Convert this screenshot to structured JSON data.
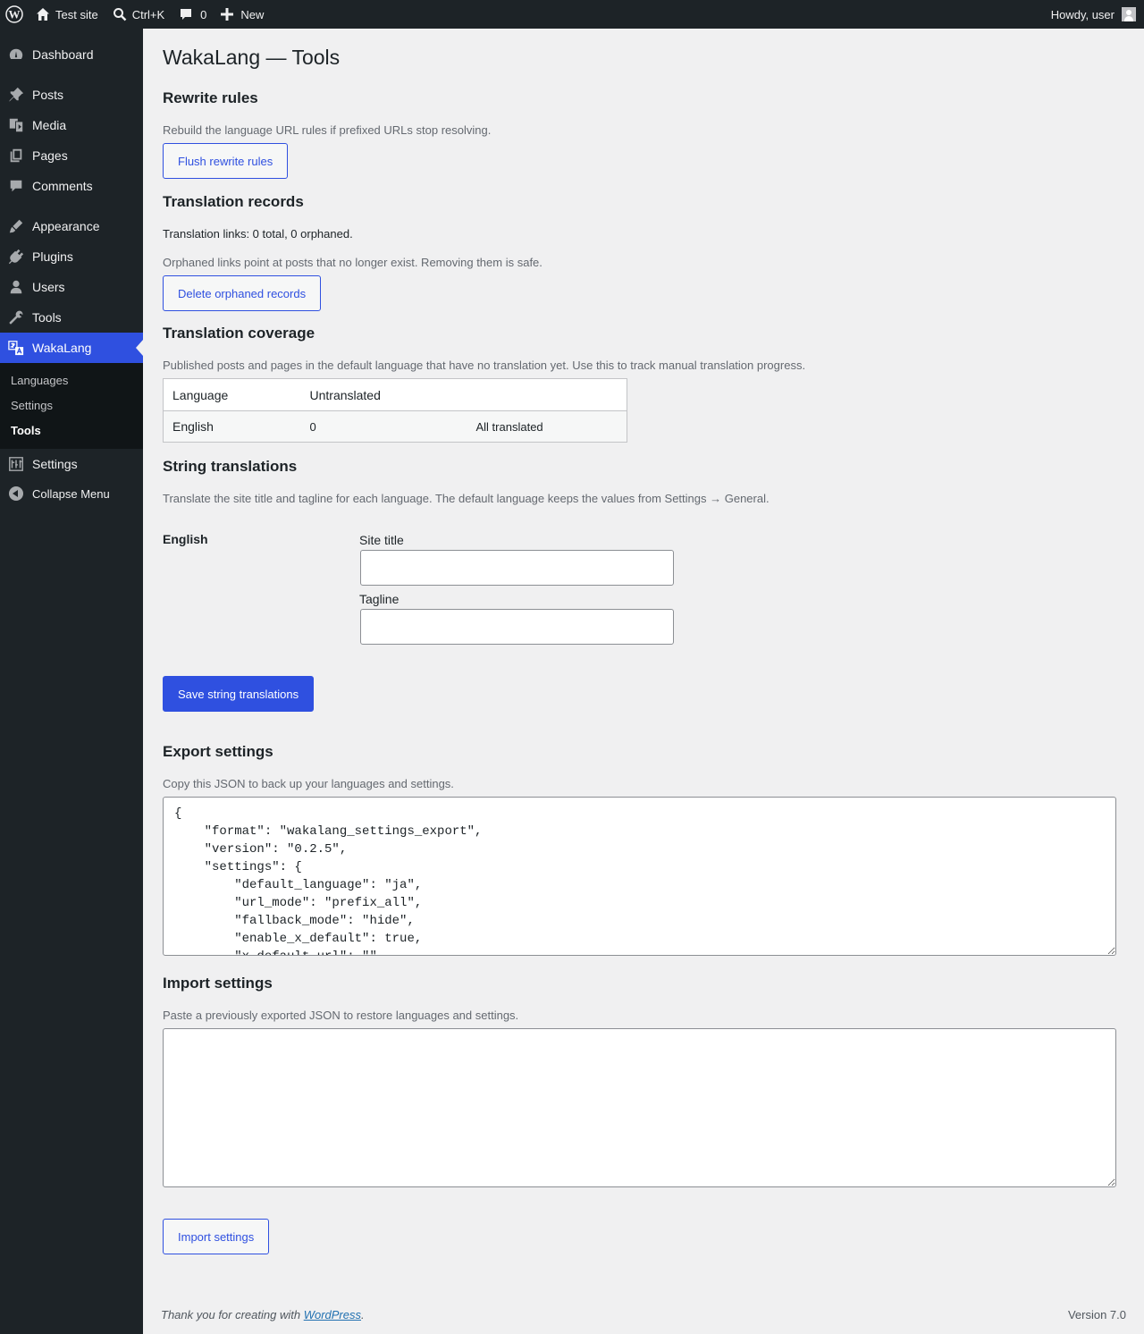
{
  "adminbar": {
    "site_name": "Test site",
    "search_shortcut": "Ctrl+K",
    "comments_count": "0",
    "new_label": "New",
    "howdy": "Howdy, user"
  },
  "sidebar": {
    "items": [
      {
        "label": "Dashboard",
        "icon": "dashboard-icon"
      },
      {
        "label": "Posts",
        "icon": "pin-icon"
      },
      {
        "label": "Media",
        "icon": "media-icon"
      },
      {
        "label": "Pages",
        "icon": "pages-icon"
      },
      {
        "label": "Comments",
        "icon": "comment-icon"
      },
      {
        "label": "Appearance",
        "icon": "brush-icon"
      },
      {
        "label": "Plugins",
        "icon": "plug-icon"
      },
      {
        "label": "Users",
        "icon": "user-icon"
      },
      {
        "label": "Tools",
        "icon": "wrench-icon"
      },
      {
        "label": "WakaLang",
        "icon": "translate-icon"
      },
      {
        "label": "Settings",
        "icon": "sliders-icon"
      }
    ],
    "submenu": [
      "Languages",
      "Settings",
      "Tools"
    ],
    "collapse_label": "Collapse Menu",
    "accent_color": "#2f50e0"
  },
  "page": {
    "title": "WakaLang — Tools",
    "rewrite": {
      "heading": "Rewrite rules",
      "description": "Rebuild the language URL rules if prefixed URLs stop resolving.",
      "button": "Flush rewrite rules"
    },
    "records": {
      "heading": "Translation records",
      "status": "Translation links: 0 total, 0 orphaned.",
      "description": "Orphaned links point at posts that no longer exist. Removing them is safe.",
      "button": "Delete orphaned records"
    },
    "coverage": {
      "heading": "Translation coverage",
      "description": "Published posts and pages in the default language that have no translation yet. Use this to track manual translation progress.",
      "columns": [
        "Language",
        "Untranslated"
      ],
      "rows": [
        {
          "language": "English",
          "untranslated": "0",
          "status": "All translated"
        }
      ]
    },
    "strings": {
      "heading": "String translations",
      "description": "Translate the site title and tagline for each language. The default language keeps the values from Settings → General.",
      "language": "English",
      "site_title_label": "Site title",
      "site_title_value": "",
      "tagline_label": "Tagline",
      "tagline_value": "",
      "button": "Save string translations"
    },
    "export": {
      "heading": "Export settings",
      "description": "Copy this JSON to back up your languages and settings.",
      "json": "{\n    \"format\": \"wakalang_settings_export\",\n    \"version\": \"0.2.5\",\n    \"settings\": {\n        \"default_language\": \"ja\",\n        \"url_mode\": \"prefix_all\",\n        \"fallback_mode\": \"hide\",\n        \"enable_x_default\": true,\n        \"x_default_url\": \"\","
    },
    "import": {
      "heading": "Import settings",
      "description": "Paste a previously exported JSON to restore languages and settings.",
      "value": "",
      "button": "Import settings"
    }
  },
  "footer": {
    "thanks_prefix": "Thank you for creating with ",
    "link": "WordPress",
    "thanks_suffix": ".",
    "version": "Version 7.0"
  }
}
